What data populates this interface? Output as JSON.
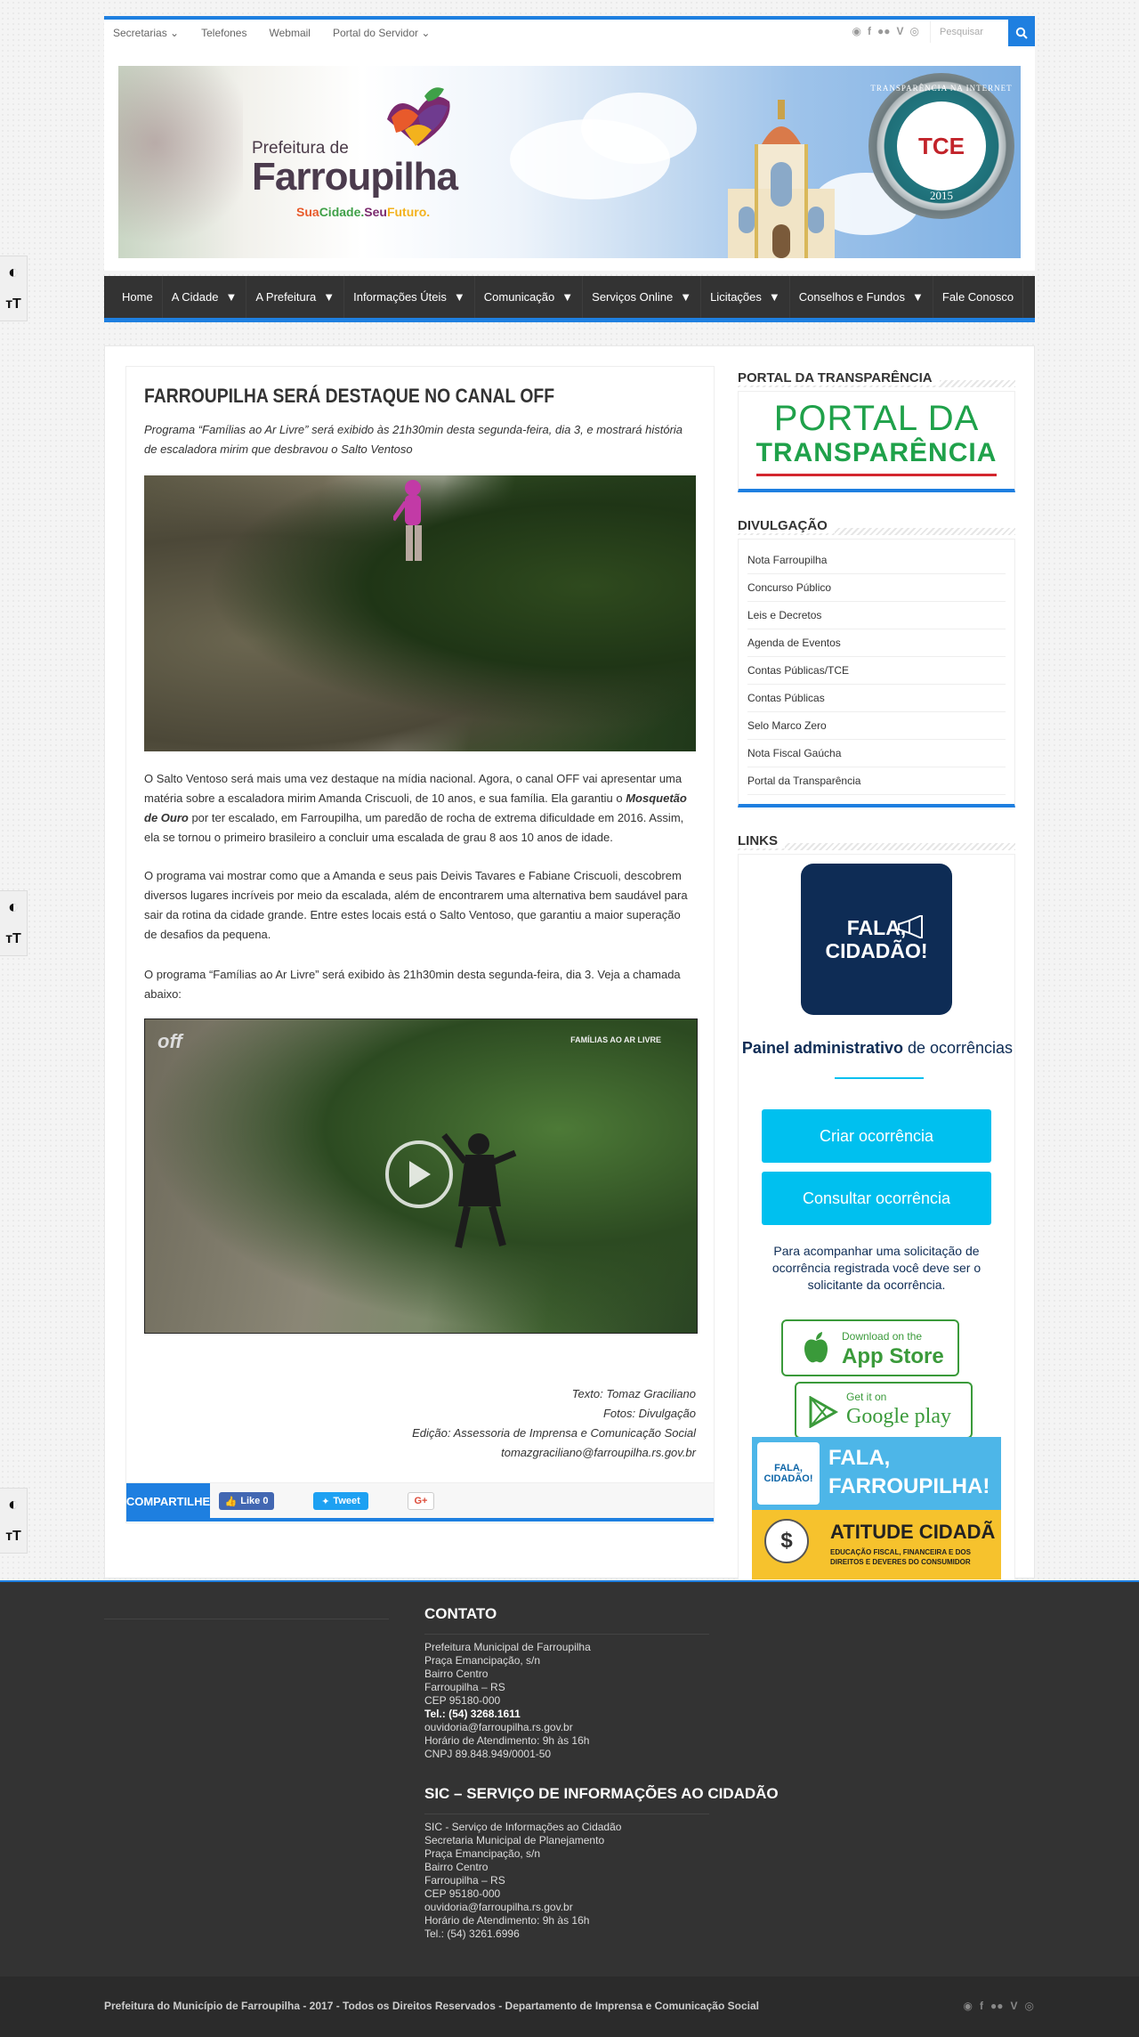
{
  "topbar": {
    "links": [
      "Secretarias",
      "Telefones",
      "Webmail",
      "Portal do Servidor"
    ],
    "search_placeholder": "Pesquisar"
  },
  "header": {
    "logo_prefix": "Prefeitura de",
    "logo_name": "Farroupilha",
    "slogan_parts": [
      "Sua",
      "Cidade.",
      "Seu",
      "Futuro."
    ],
    "seal_top": "TRANSPARÊNCIA NA INTERNET",
    "seal_center": "TCE",
    "seal_year": "2015"
  },
  "nav": {
    "items": [
      {
        "label": "Home",
        "caret": false
      },
      {
        "label": "A Cidade",
        "caret": true
      },
      {
        "label": "A Prefeitura",
        "caret": true
      },
      {
        "label": "Informações Úteis",
        "caret": true
      },
      {
        "label": "Comunicação",
        "caret": true
      },
      {
        "label": "Serviços Online",
        "caret": true
      },
      {
        "label": "Licitações",
        "caret": true
      },
      {
        "label": "Conselhos e Fundos",
        "caret": true
      },
      {
        "label": "Fale Conosco",
        "caret": false
      }
    ]
  },
  "post": {
    "title": "FARROUPILHA SERÁ DESTAQUE NO CANAL OFF",
    "subtitle": "Programa “Famílias ao Ar Livre” será exibido às 21h30min desta segunda-feira, dia 3, e mostrará história de escaladora mirim que desbravou o Salto Ventoso",
    "p1_a": "O Salto Ventoso será mais uma vez destaque na mídia nacional. Agora, o canal OFF vai apresentar uma matéria sobre a escaladora mirim Amanda Criscuoli, de 10 anos, e sua família. Ela garantiu o ",
    "p1_b": "Mosquetão de Ouro",
    "p1_c": " por ter escalado, em Farroupilha, um paredão de rocha de extrema dificuldade em 2016. Assim, ela se tornou o primeiro brasileiro a concluir uma escalada de grau 8 aos 10 anos de idade.",
    "p2": "O programa vai mostrar como que a Amanda e seus pais Deivis Tavares e Fabiane Criscuoli, descobrem diversos lugares incríveis por meio da escalada, além de encontrarem uma alternativa bem saudável para sair da rotina da cidade grande. Entre estes locais está o Salto Ventoso, que garantiu a maior superação de desafios da pequena.",
    "p3": "O programa “Famílias ao Ar Livre” será exibido às 21h30min desta segunda-feira, dia 3. Veja a chamada abaixo:",
    "video_logo": "off",
    "video_tag": "FAMÍLIAS AO AR LIVRE",
    "credits": [
      "Texto: Tomaz Graciliano",
      "Fotos: Divulgação",
      "Edição: Assessoria de Imprensa e Comunicação Social",
      "tomazgraciliano@farroupilha.rs.gov.br"
    ],
    "share_label": "COMPARTILHE",
    "fb_label": "Like 0",
    "tw_label": "Tweet",
    "gp_label": "G+"
  },
  "sidebar": {
    "portal_title": "PORTAL DA TRANSPARÊNCIA",
    "portal_line1": "PORTAL DA",
    "portal_line2": "TRANSPARÊNCIA",
    "divulgacao_title": "DIVULGAÇÃO",
    "divulgacao_items": [
      "Nota Farroupilha",
      "Concurso Público",
      "Leis e Decretos",
      "Agenda de Eventos",
      "Contas Públicas/TCE",
      "Contas Públicas",
      "Selo Marco Zero",
      "Nota Fiscal Gaúcha",
      "Portal da Transparência"
    ],
    "links_title": "LINKS",
    "fala_line1": "FALA,",
    "fala_line2": "CIDADÃO!",
    "painel_bold": "Painel administrativo",
    "painel_rest": " de ocorrências",
    "btn_criar": "Criar ocorrência",
    "btn_consultar": "Consultar ocorrência",
    "para": "Para acompanhar uma solicitação de ocorrência registrada você deve ser o solicitante da ocorrência.",
    "appstore_small": "Download on the",
    "appstore_big": "App Store",
    "gplay_small": "Get it on",
    "gplay_big": "Google play",
    "banner_fala_logo": "FALA, CIDADÃO!",
    "banner_fala_l1": "FALA,",
    "banner_fala_l2": "FARROUPILHA!",
    "banner_at_title": "ATITUDE CIDADÃ",
    "banner_at_sub": "EDUCAÇÃO FISCAL, FINANCEIRA E DOS DIREITOS E DEVERES DO CONSUMIDOR"
  },
  "footer": {
    "contato_title": "CONTATO",
    "contato_lines": [
      "Prefeitura Municipal de Farroupilha",
      "Praça Emancipação, s/n",
      "Bairro Centro",
      "Farroupilha – RS",
      "CEP 95180-000"
    ],
    "contato_tel": "Tel.: (54) 3268.1611",
    "contato_lines2": [
      "ouvidoria@farroupilha.rs.gov.br",
      "Horário de Atendimento: 9h às 16h",
      "CNPJ 89.848.949/0001-50"
    ],
    "sic_title": "SIC – SERVIÇO DE INFORMAÇÕES AO CIDADÃO",
    "sic_lines": [
      "SIC - Serviço de Informações ao Cidadão",
      "Secretaria Municipal de Planejamento",
      "Praça Emancipação, s/n",
      "Bairro Centro",
      "Farroupilha – RS",
      "CEP 95180-000",
      "ouvidoria@farroupilha.rs.gov.br",
      "Horário de Atendimento: 9h às 16h",
      "Tel.: (54) 3261.6996"
    ],
    "copyright": "Prefeitura do Município de Farroupilha - 2017 - Todos os Direitos Reservados - Departamento de Imprensa e Comunicação Social"
  },
  "colors": {
    "accent": "#1e7fe0",
    "nav_bg": "#333333",
    "portal_green": "#1fa14a",
    "fala_navy": "#0e2c55",
    "cyan_button": "#00c0ef"
  }
}
